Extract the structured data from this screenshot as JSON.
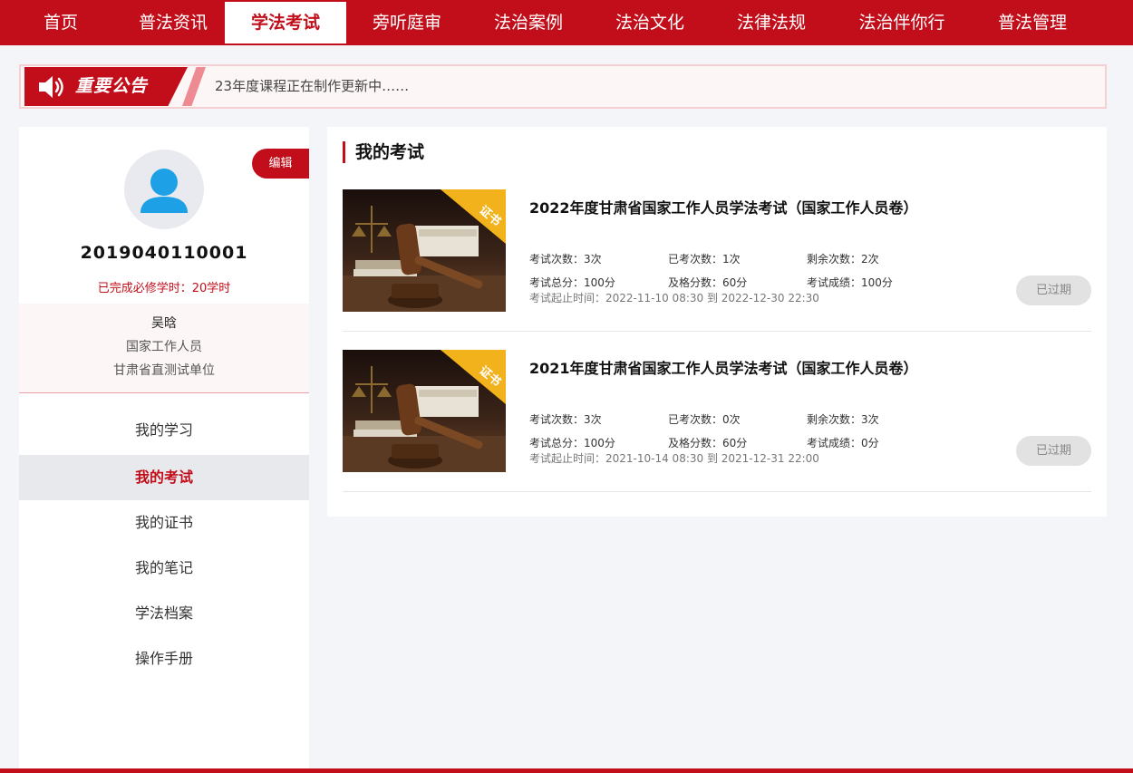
{
  "nav": {
    "items": [
      "首页",
      "普法资讯",
      "学法考试",
      "旁听庭审",
      "法治案例",
      "法治文化",
      "法律法规",
      "法治伴你行",
      "普法管理"
    ],
    "active_index": 2
  },
  "notice": {
    "title": "重要公告",
    "text": "23年度课程正在制作更新中……"
  },
  "profile": {
    "edit_label": "编辑",
    "username": "2019040110001",
    "hours": "已完成必修学时：20学时",
    "name": "吴晗",
    "role": "国家工作人员",
    "unit": "甘肃省直测试单位"
  },
  "menu": {
    "items": [
      "我的学习",
      "我的考试",
      "我的证书",
      "我的笔记",
      "学法档案",
      "操作手册"
    ],
    "active_index": 1
  },
  "main": {
    "title": "我的考试",
    "exams": [
      {
        "badge": "证书",
        "title": "2022年度甘肃省国家工作人员学法考试（国家工作人员卷）",
        "attempts": "考试次数：3次",
        "taken": "已考次数：1次",
        "remaining": "剩余次数：2次",
        "total": "考试总分：100分",
        "pass": "及格分数：60分",
        "score": "考试成绩：100分",
        "time": "考试起止时间：2022-11-10 08:30 到 2022-12-30 22:30",
        "status": "已过期"
      },
      {
        "badge": "证书",
        "title": "2021年度甘肃省国家工作人员学法考试（国家工作人员卷）",
        "attempts": "考试次数：3次",
        "taken": "已考次数：0次",
        "remaining": "剩余次数：3次",
        "total": "考试总分：100分",
        "pass": "及格分数：60分",
        "score": "考试成绩：0分",
        "time": "考试起止时间：2021-10-14 08:30 到 2021-12-31 22:00",
        "status": "已过期"
      }
    ]
  },
  "colors": {
    "brand_red": "#c20e1a",
    "badge_yellow": "#f2b21b",
    "page_bg": "#f4f5f8"
  },
  "icons": {
    "notice": "speaker-icon",
    "avatar": "user-avatar-icon"
  }
}
